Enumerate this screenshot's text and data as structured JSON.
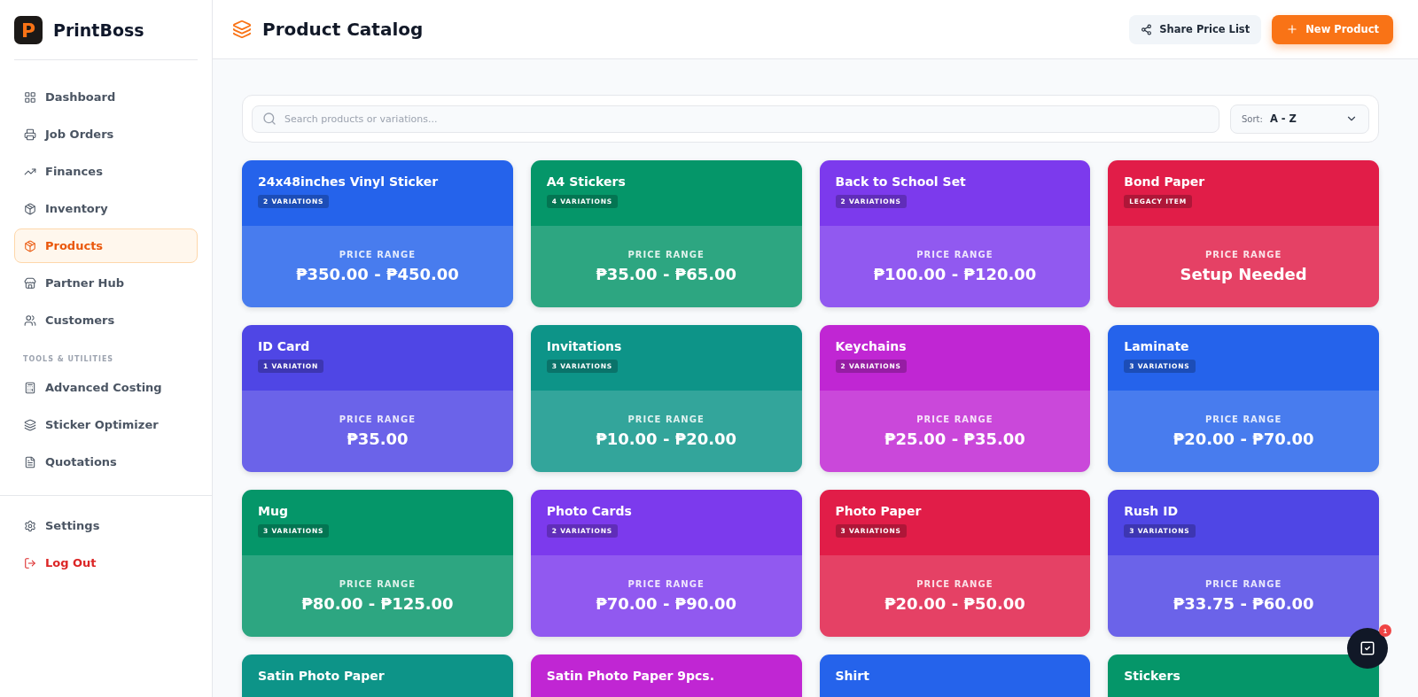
{
  "brand": {
    "name": "PrintBoss",
    "logo_letter": "P"
  },
  "sidebar": {
    "items": [
      {
        "label": "Dashboard",
        "selected": false
      },
      {
        "label": "Job Orders",
        "selected": false
      },
      {
        "label": "Finances",
        "selected": false
      },
      {
        "label": "Inventory",
        "selected": false
      },
      {
        "label": "Products",
        "selected": true
      },
      {
        "label": "Partner Hub",
        "selected": false
      },
      {
        "label": "Customers",
        "selected": false
      }
    ],
    "section_label": "TOOLS & UTILITIES",
    "tools": [
      {
        "label": "Advanced Costing",
        "selected": false
      },
      {
        "label": "Sticker Optimizer",
        "selected": false
      },
      {
        "label": "Quotations",
        "selected": false
      }
    ],
    "footer": [
      {
        "label": "Settings",
        "kind": "normal"
      },
      {
        "label": "Log Out",
        "kind": "danger"
      }
    ]
  },
  "header": {
    "title": "Product Catalog",
    "share_button": "Share Price List",
    "new_button": "New Product"
  },
  "search": {
    "placeholder": "Search products or variations..."
  },
  "sort": {
    "label": "Sort:",
    "value": "A - Z"
  },
  "products": [
    {
      "name": "24x48inches Vinyl Sticker",
      "badge": "2 VARIATIONS",
      "price_label": "PRICE RANGE",
      "price": "₱350.00 - ₱450.00",
      "color": "#2563eb"
    },
    {
      "name": "A4 Stickers",
      "badge": "4 VARIATIONS",
      "price_label": "PRICE RANGE",
      "price": "₱35.00 - ₱65.00",
      "color": "#059669"
    },
    {
      "name": "Back to School Set",
      "badge": "2 VARIATIONS",
      "price_label": "PRICE RANGE",
      "price": "₱100.00 - ₱120.00",
      "color": "#7c3aed"
    },
    {
      "name": "Bond Paper",
      "badge": "LEGACY ITEM",
      "price_label": "PRICE RANGE",
      "price": "Setup Needed",
      "color": "#e11d48"
    },
    {
      "name": "ID Card",
      "badge": "1 VARIATION",
      "price_label": "PRICE RANGE",
      "price": "₱35.00",
      "color": "#4f46e5"
    },
    {
      "name": "Invitations",
      "badge": "3 VARIATIONS",
      "price_label": "PRICE RANGE",
      "price": "₱10.00 - ₱20.00",
      "color": "#0d9488"
    },
    {
      "name": "Keychains",
      "badge": "2 VARIATIONS",
      "price_label": "PRICE RANGE",
      "price": "₱25.00 - ₱35.00",
      "color": "#c026d3"
    },
    {
      "name": "Laminate",
      "badge": "3 VARIATIONS",
      "price_label": "PRICE RANGE",
      "price": "₱20.00 - ₱70.00",
      "color": "#2563eb"
    },
    {
      "name": "Mug",
      "badge": "3 VARIATIONS",
      "price_label": "PRICE RANGE",
      "price": "₱80.00 - ₱125.00",
      "color": "#059669"
    },
    {
      "name": "Photo Cards",
      "badge": "2 VARIATIONS",
      "price_label": "PRICE RANGE",
      "price": "₱70.00 - ₱90.00",
      "color": "#7c3aed"
    },
    {
      "name": "Photo Paper",
      "badge": "3 VARIATIONS",
      "price_label": "PRICE RANGE",
      "price": "₱20.00 - ₱50.00",
      "color": "#e11d48"
    },
    {
      "name": "Rush ID",
      "badge": "3 VARIATIONS",
      "price_label": "PRICE RANGE",
      "price": "₱33.75 - ₱60.00",
      "color": "#4f46e5"
    },
    {
      "name": "Satin Photo Paper",
      "color": "#0d9488"
    },
    {
      "name": "Satin Photo Paper 9pcs.",
      "color": "#c026d3"
    },
    {
      "name": "Shirt",
      "color": "#2563eb"
    },
    {
      "name": "Stickers",
      "color": "#059669"
    }
  ],
  "task_button": {
    "count": "1"
  }
}
